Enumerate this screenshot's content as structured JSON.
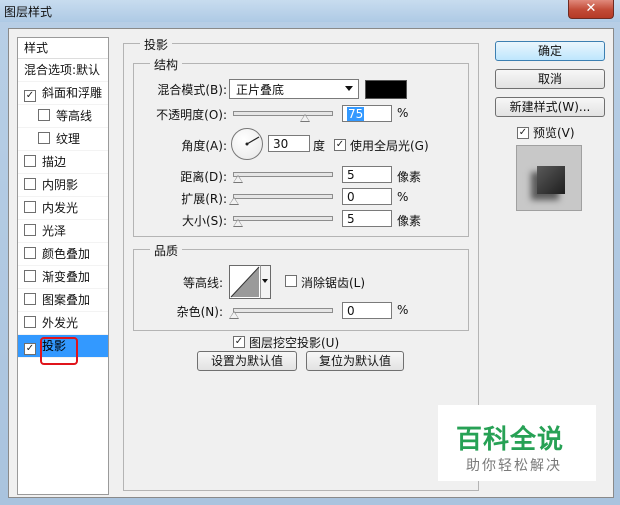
{
  "window": {
    "title": "图层样式",
    "close_glyph": "✕"
  },
  "sidebar": {
    "header": "样式",
    "items": [
      {
        "label": "混合选项:默认",
        "checkbox": false
      },
      {
        "label": "斜面和浮雕",
        "checkbox": true,
        "checked": true
      },
      {
        "label": "等高线",
        "checkbox": true,
        "checked": false,
        "sub": true
      },
      {
        "label": "纹理",
        "checkbox": true,
        "checked": false,
        "sub": true
      },
      {
        "label": "描边",
        "checkbox": true,
        "checked": false
      },
      {
        "label": "内阴影",
        "checkbox": true,
        "checked": false
      },
      {
        "label": "内发光",
        "checkbox": true,
        "checked": false
      },
      {
        "label": "光泽",
        "checkbox": true,
        "checked": false
      },
      {
        "label": "颜色叠加",
        "checkbox": true,
        "checked": false
      },
      {
        "label": "渐变叠加",
        "checkbox": true,
        "checked": false
      },
      {
        "label": "图案叠加",
        "checkbox": true,
        "checked": false
      },
      {
        "label": "外发光",
        "checkbox": true,
        "checked": false
      },
      {
        "label": "投影",
        "checkbox": true,
        "checked": true,
        "selected": true
      }
    ]
  },
  "drop_shadow": {
    "title": "投影",
    "structure": {
      "title": "结构",
      "blend_mode_label": "混合模式(B):",
      "blend_mode_value": "正片叠底",
      "blend_color": "#000000",
      "opacity_label": "不透明度(O):",
      "opacity_value": "75",
      "opacity_unit": "%",
      "angle_label": "角度(A):",
      "angle_value": "30",
      "angle_unit": "度",
      "global_light_label": "使用全局光(G)",
      "global_light_checked": true,
      "distance_label": "距离(D):",
      "distance_value": "5",
      "distance_unit": "像素",
      "spread_label": "扩展(R):",
      "spread_value": "0",
      "spread_unit": "%",
      "size_label": "大小(S):",
      "size_value": "5",
      "size_unit": "像素"
    },
    "quality": {
      "title": "品质",
      "contour_label": "等高线:",
      "anti_alias_label": "消除锯齿(L)",
      "anti_alias_checked": false,
      "noise_label": "杂色(N):",
      "noise_value": "0",
      "noise_unit": "%"
    },
    "knockout_label": "图层挖空投影(U)",
    "knockout_checked": true,
    "set_default_label": "设置为默认值",
    "reset_default_label": "复位为默认值"
  },
  "buttons": {
    "ok": "确定",
    "cancel": "取消",
    "new_style": "新建样式(W)...",
    "preview_label": "预览(V)",
    "preview_checked": true
  },
  "watermark": {
    "main": "百科全说",
    "sub": "助你轻松解决"
  },
  "check_glyph": "✓"
}
